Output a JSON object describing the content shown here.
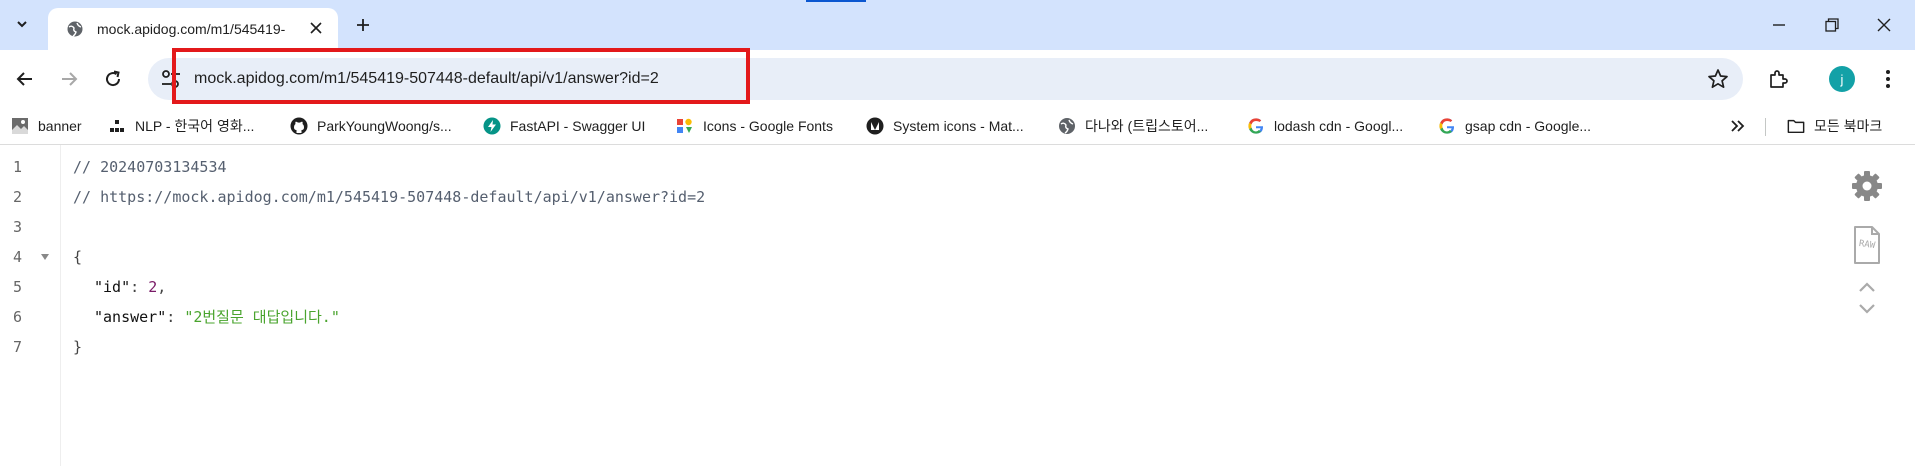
{
  "tabs": [
    {
      "title": "mock.apidog.com/m1/545419-",
      "close_icon": "close-icon",
      "favicon": "globe-icon"
    }
  ],
  "new_tab_label": "+",
  "address_bar": {
    "url": "mock.apidog.com/m1/545419-507448-default/api/v1/answer?id=2",
    "site_info_icon": "tune-icon",
    "bookmark_icon": "star-icon"
  },
  "profile": {
    "initial": "j",
    "color": "#13a1a7"
  },
  "bookmarks": [
    {
      "label": "banner",
      "icon": "image-icon"
    },
    {
      "label": "NLP - 한국어 영화...",
      "icon": "dots-icon"
    },
    {
      "label": "ParkYoungWoong/s...",
      "icon": "github-icon"
    },
    {
      "label": "FastAPI - Swagger UI",
      "icon": "fastapi-icon"
    },
    {
      "label": "Icons - Google Fonts",
      "icon": "google-fonts-icon"
    },
    {
      "label": "System icons - Mat...",
      "icon": "material-icon"
    },
    {
      "label": "다나와 (트립스토어...",
      "icon": "globe-icon"
    },
    {
      "label": "lodash cdn - Googl...",
      "icon": "google-icon"
    },
    {
      "label": "gsap cdn - Google...",
      "icon": "google-icon"
    }
  ],
  "bookmarks_more_icon": "double-chevron-icon",
  "all_bookmarks": {
    "label": "모든 북마크",
    "icon": "folder-icon"
  },
  "editor": {
    "line_numbers": [
      "1",
      "2",
      "3",
      "4",
      "5",
      "6",
      "7"
    ],
    "line1": "// 20240703134534",
    "line2": "// https://mock.apidog.com/m1/545419-507448-default/api/v1/answer?id=2",
    "open_brace": "{",
    "id_key": "\"id\"",
    "id_value": "2",
    "answer_key": "\"answer\"",
    "answer_value": "\"2번질문 대답입니다.\"",
    "close_brace": "}",
    "colon": ": ",
    "comma": ","
  },
  "side_tools": [
    "gear-icon",
    "raw-icon",
    "chevron-up-icon",
    "chevron-down-icon"
  ],
  "side_raw_label": "RAW",
  "colors": {
    "tabstrip": "#d3e3fd",
    "highlight": "#e3191b",
    "string": "#4aa42e",
    "number": "#7a1b67"
  }
}
